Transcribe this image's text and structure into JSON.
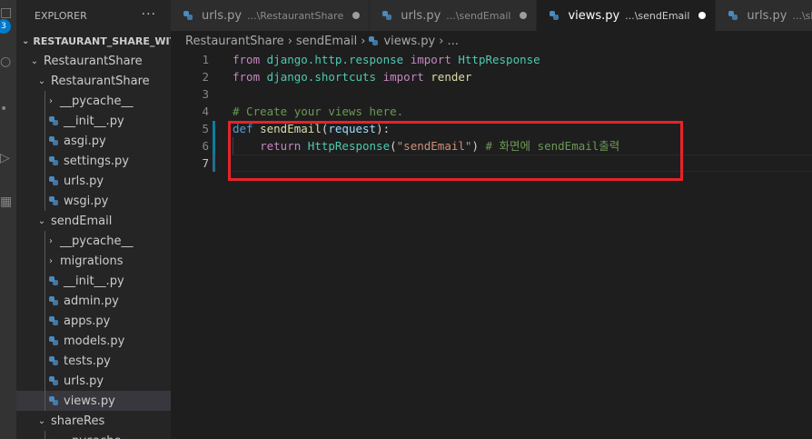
{
  "activity": {
    "badge": "3"
  },
  "sidebar": {
    "title": "EXPLORER",
    "more": "···",
    "section": "RESTAURANT_SHARE_WIT...",
    "items": [
      {
        "label": "RestaurantShare",
        "kind": "folder-open"
      },
      {
        "label": "RestaurantShare",
        "kind": "folder-open"
      },
      {
        "label": "__pycache__",
        "kind": "folder-closed"
      },
      {
        "label": "__init__.py",
        "kind": "py"
      },
      {
        "label": "asgi.py",
        "kind": "py"
      },
      {
        "label": "settings.py",
        "kind": "py"
      },
      {
        "label": "urls.py",
        "kind": "py"
      },
      {
        "label": "wsgi.py",
        "kind": "py"
      },
      {
        "label": "sendEmail",
        "kind": "folder-open"
      },
      {
        "label": "__pycache__",
        "kind": "folder-closed"
      },
      {
        "label": "migrations",
        "kind": "folder-closed"
      },
      {
        "label": "__init__.py",
        "kind": "py"
      },
      {
        "label": "admin.py",
        "kind": "py"
      },
      {
        "label": "apps.py",
        "kind": "py"
      },
      {
        "label": "models.py",
        "kind": "py"
      },
      {
        "label": "tests.py",
        "kind": "py"
      },
      {
        "label": "urls.py",
        "kind": "py"
      },
      {
        "label": "views.py",
        "kind": "py"
      },
      {
        "label": "shareRes",
        "kind": "folder-open"
      },
      {
        "label": "__pycache__",
        "kind": "folder-closed"
      }
    ]
  },
  "tabs": [
    {
      "name": "urls.py",
      "desc": "...\\RestaurantShare",
      "dirty": true
    },
    {
      "name": "urls.py",
      "desc": "...\\sendEmail",
      "dirty": true
    },
    {
      "name": "views.py",
      "desc": "...\\sendEmail",
      "dirty": true,
      "active": true
    },
    {
      "name": "urls.py",
      "desc": "...\\shareRes",
      "dirty": false
    }
  ],
  "breadcrumb": {
    "folder": "RestaurantShare",
    "subfolder": "sendEmail",
    "file": "views.py",
    "tail": "..."
  },
  "editor": {
    "current_line": 7,
    "lines": [
      {
        "n": "1",
        "tokens": [
          [
            "kw",
            "from"
          ],
          [
            "pun",
            " "
          ],
          [
            "mod",
            "django.http.response"
          ],
          [
            "pun",
            " "
          ],
          [
            "kw",
            "import"
          ],
          [
            "pun",
            " "
          ],
          [
            "mod",
            "HttpResponse"
          ]
        ]
      },
      {
        "n": "2",
        "tokens": [
          [
            "kw",
            "from"
          ],
          [
            "pun",
            " "
          ],
          [
            "mod",
            "django.shortcuts"
          ],
          [
            "pun",
            " "
          ],
          [
            "kw",
            "import"
          ],
          [
            "pun",
            " "
          ],
          [
            "fn",
            "render"
          ]
        ]
      },
      {
        "n": "3",
        "tokens": []
      },
      {
        "n": "4",
        "tokens": [
          [
            "com",
            "# Create your views here."
          ]
        ]
      },
      {
        "n": "5",
        "tokens": [
          [
            "def",
            "def"
          ],
          [
            "pun",
            " "
          ],
          [
            "fn",
            "sendEmail"
          ],
          [
            "pun",
            "("
          ],
          [
            "param",
            "request"
          ],
          [
            "pun",
            "):"
          ]
        ]
      },
      {
        "n": "6",
        "tokens": [
          [
            "pun",
            "    "
          ],
          [
            "kw",
            "return"
          ],
          [
            "pun",
            " "
          ],
          [
            "mod",
            "HttpResponse"
          ],
          [
            "pun",
            "("
          ],
          [
            "str",
            "\"sendEmail\""
          ],
          [
            "pun",
            ") "
          ],
          [
            "com",
            "# 화면에 sendEmail출력"
          ]
        ]
      },
      {
        "n": "7",
        "tokens": []
      }
    ]
  },
  "colors": {
    "highlight_box": "#e8222a",
    "accent": "#007acc"
  }
}
